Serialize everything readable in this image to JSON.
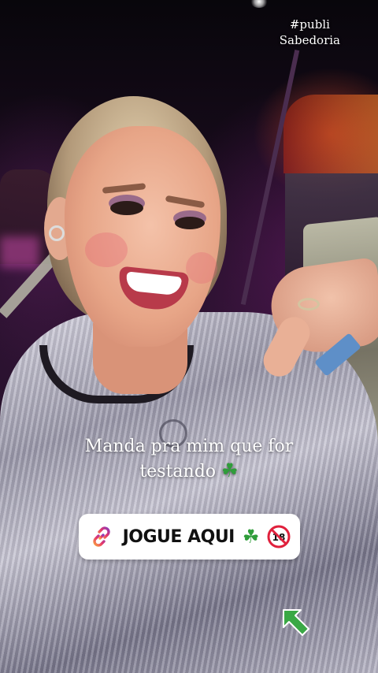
{
  "story": {
    "hashtag": "#publi",
    "sponsor": "Sabedoria",
    "caption_line1": "Manda pra mim que for",
    "caption_line2": "testando",
    "caption_emoji": "☘",
    "link_sticker": {
      "label": "JOGUE AQUI",
      "clover_emoji": "☘",
      "icons": [
        "link-icon",
        "clover-icon",
        "no-under-18-icon"
      ]
    },
    "arrow_sticker": "up-left-arrow-icon"
  },
  "colors": {
    "link_icon_gradient": [
      "#f9a03f",
      "#e6366b",
      "#8a3ab9"
    ],
    "clover": "#2f9d3a",
    "no18_red": "#e0203c",
    "arrow_green": "#3aa845"
  }
}
